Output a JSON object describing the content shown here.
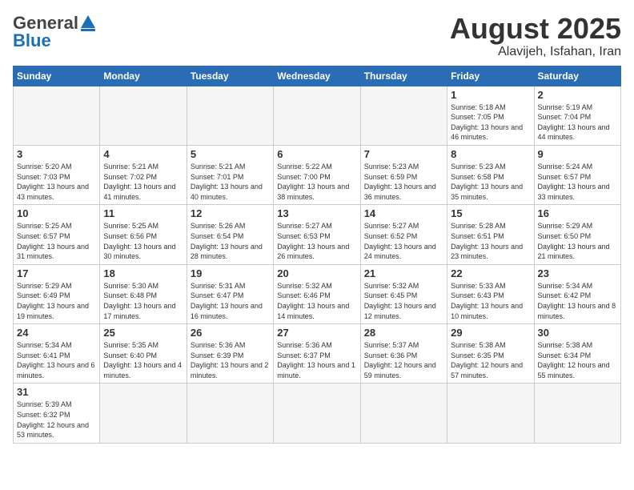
{
  "header": {
    "logo_general": "General",
    "logo_blue": "Blue",
    "month_title": "August 2025",
    "location": "Alavijeh, Isfahan, Iran"
  },
  "weekdays": [
    "Sunday",
    "Monday",
    "Tuesday",
    "Wednesday",
    "Thursday",
    "Friday",
    "Saturday"
  ],
  "weeks": [
    [
      {
        "day": "",
        "info": ""
      },
      {
        "day": "",
        "info": ""
      },
      {
        "day": "",
        "info": ""
      },
      {
        "day": "",
        "info": ""
      },
      {
        "day": "",
        "info": ""
      },
      {
        "day": "1",
        "info": "Sunrise: 5:18 AM\nSunset: 7:05 PM\nDaylight: 13 hours and 46 minutes."
      },
      {
        "day": "2",
        "info": "Sunrise: 5:19 AM\nSunset: 7:04 PM\nDaylight: 13 hours and 44 minutes."
      }
    ],
    [
      {
        "day": "3",
        "info": "Sunrise: 5:20 AM\nSunset: 7:03 PM\nDaylight: 13 hours and 43 minutes."
      },
      {
        "day": "4",
        "info": "Sunrise: 5:21 AM\nSunset: 7:02 PM\nDaylight: 13 hours and 41 minutes."
      },
      {
        "day": "5",
        "info": "Sunrise: 5:21 AM\nSunset: 7:01 PM\nDaylight: 13 hours and 40 minutes."
      },
      {
        "day": "6",
        "info": "Sunrise: 5:22 AM\nSunset: 7:00 PM\nDaylight: 13 hours and 38 minutes."
      },
      {
        "day": "7",
        "info": "Sunrise: 5:23 AM\nSunset: 6:59 PM\nDaylight: 13 hours and 36 minutes."
      },
      {
        "day": "8",
        "info": "Sunrise: 5:23 AM\nSunset: 6:58 PM\nDaylight: 13 hours and 35 minutes."
      },
      {
        "day": "9",
        "info": "Sunrise: 5:24 AM\nSunset: 6:57 PM\nDaylight: 13 hours and 33 minutes."
      }
    ],
    [
      {
        "day": "10",
        "info": "Sunrise: 5:25 AM\nSunset: 6:57 PM\nDaylight: 13 hours and 31 minutes."
      },
      {
        "day": "11",
        "info": "Sunrise: 5:25 AM\nSunset: 6:56 PM\nDaylight: 13 hours and 30 minutes."
      },
      {
        "day": "12",
        "info": "Sunrise: 5:26 AM\nSunset: 6:54 PM\nDaylight: 13 hours and 28 minutes."
      },
      {
        "day": "13",
        "info": "Sunrise: 5:27 AM\nSunset: 6:53 PM\nDaylight: 13 hours and 26 minutes."
      },
      {
        "day": "14",
        "info": "Sunrise: 5:27 AM\nSunset: 6:52 PM\nDaylight: 13 hours and 24 minutes."
      },
      {
        "day": "15",
        "info": "Sunrise: 5:28 AM\nSunset: 6:51 PM\nDaylight: 13 hours and 23 minutes."
      },
      {
        "day": "16",
        "info": "Sunrise: 5:29 AM\nSunset: 6:50 PM\nDaylight: 13 hours and 21 minutes."
      }
    ],
    [
      {
        "day": "17",
        "info": "Sunrise: 5:29 AM\nSunset: 6:49 PM\nDaylight: 13 hours and 19 minutes."
      },
      {
        "day": "18",
        "info": "Sunrise: 5:30 AM\nSunset: 6:48 PM\nDaylight: 13 hours and 17 minutes."
      },
      {
        "day": "19",
        "info": "Sunrise: 5:31 AM\nSunset: 6:47 PM\nDaylight: 13 hours and 16 minutes."
      },
      {
        "day": "20",
        "info": "Sunrise: 5:32 AM\nSunset: 6:46 PM\nDaylight: 13 hours and 14 minutes."
      },
      {
        "day": "21",
        "info": "Sunrise: 5:32 AM\nSunset: 6:45 PM\nDaylight: 13 hours and 12 minutes."
      },
      {
        "day": "22",
        "info": "Sunrise: 5:33 AM\nSunset: 6:43 PM\nDaylight: 13 hours and 10 minutes."
      },
      {
        "day": "23",
        "info": "Sunrise: 5:34 AM\nSunset: 6:42 PM\nDaylight: 13 hours and 8 minutes."
      }
    ],
    [
      {
        "day": "24",
        "info": "Sunrise: 5:34 AM\nSunset: 6:41 PM\nDaylight: 13 hours and 6 minutes."
      },
      {
        "day": "25",
        "info": "Sunrise: 5:35 AM\nSunset: 6:40 PM\nDaylight: 13 hours and 4 minutes."
      },
      {
        "day": "26",
        "info": "Sunrise: 5:36 AM\nSunset: 6:39 PM\nDaylight: 13 hours and 2 minutes."
      },
      {
        "day": "27",
        "info": "Sunrise: 5:36 AM\nSunset: 6:37 PM\nDaylight: 13 hours and 1 minute."
      },
      {
        "day": "28",
        "info": "Sunrise: 5:37 AM\nSunset: 6:36 PM\nDaylight: 12 hours and 59 minutes."
      },
      {
        "day": "29",
        "info": "Sunrise: 5:38 AM\nSunset: 6:35 PM\nDaylight: 12 hours and 57 minutes."
      },
      {
        "day": "30",
        "info": "Sunrise: 5:38 AM\nSunset: 6:34 PM\nDaylight: 12 hours and 55 minutes."
      }
    ],
    [
      {
        "day": "31",
        "info": "Sunrise: 5:39 AM\nSunset: 6:32 PM\nDaylight: 12 hours and 53 minutes."
      },
      {
        "day": "",
        "info": ""
      },
      {
        "day": "",
        "info": ""
      },
      {
        "day": "",
        "info": ""
      },
      {
        "day": "",
        "info": ""
      },
      {
        "day": "",
        "info": ""
      },
      {
        "day": "",
        "info": ""
      }
    ]
  ]
}
